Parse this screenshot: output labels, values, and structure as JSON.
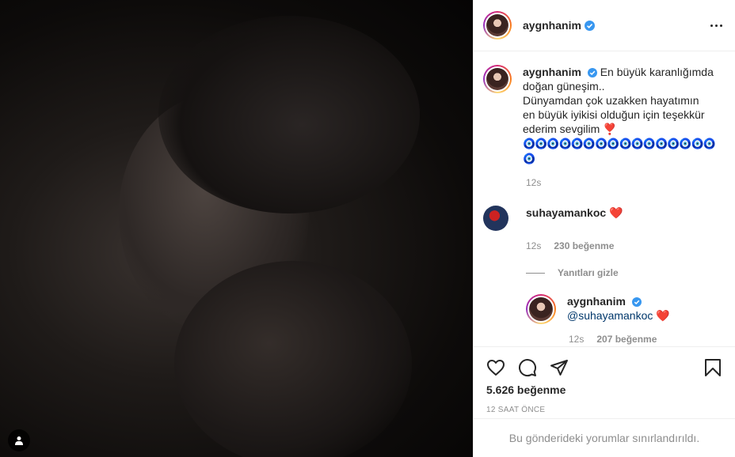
{
  "post": {
    "username": "aygnhanim",
    "verified": true,
    "caption_line1": "En büyük karanlığımda",
    "caption_line2": "doğan güneşim..",
    "caption_line3": "Dünyamdan çok uzakken hayatımın",
    "caption_line4": "en büyük iyikisi olduğun için teşekkür",
    "caption_line5": "ederim sevgilim",
    "caption_heart": "❣️",
    "caption_eyes": "🧿🧿🧿🧿🧿🧿🧿🧿🧿🧿🧿🧿🧿🧿🧿🧿🧿",
    "caption_time": "12s",
    "likes": "5.626 beğenme",
    "posted_ago": "12 SAAT ÖNCE",
    "comments_limited": "Bu gönderideki yorumlar sınırlandırıldı."
  },
  "comments": [
    {
      "username": "suhayamankoc",
      "text": "❤️",
      "time": "12s",
      "likes": "230 beğenme",
      "toggle_replies": "Yanıtları gizle",
      "replies": [
        {
          "username": "aygnhanim",
          "mention": "@suhayamankoc",
          "text": "❤️",
          "time": "12s",
          "likes": "207 beğenme"
        }
      ]
    }
  ],
  "colors": {
    "verified": "#3897f0",
    "mention": "#00376b",
    "heart": "#e0245e",
    "muted": "#8e8e8e"
  },
  "icons": [
    "more-icon",
    "heart-icon",
    "comment-icon",
    "share-icon",
    "bookmark-icon",
    "user-tag-icon",
    "verified-icon"
  ]
}
